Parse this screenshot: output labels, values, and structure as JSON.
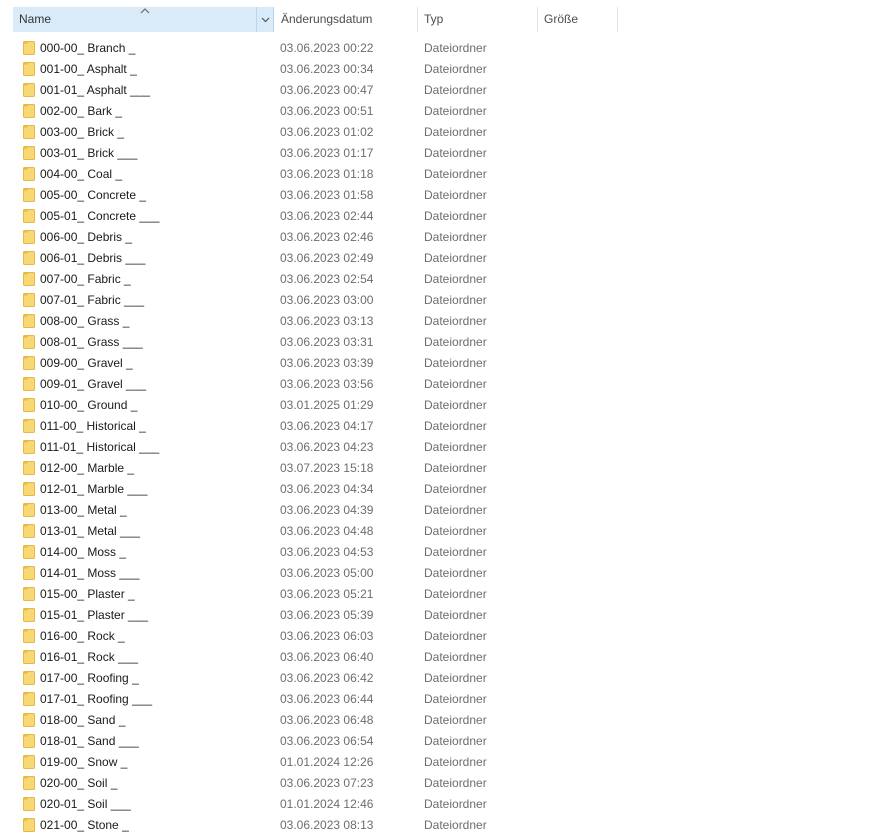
{
  "columns": {
    "name": "Name",
    "date": "Änderungsdatum",
    "type": "Typ",
    "size": "Größe"
  },
  "icons": {
    "folder": "folder-icon",
    "sort": "sort-ascending-icon",
    "dropdown": "chevron-down-icon",
    "folder_color": "#f8d775",
    "folder_edge": "#e6b944",
    "header_selected_bg": "#d9ebf9"
  },
  "files": [
    {
      "name": "000-00_ Branch _",
      "date": "03.06.2023 00:22",
      "type": "Dateiordner",
      "size": ""
    },
    {
      "name": "001-00_ Asphalt _",
      "date": "03.06.2023 00:34",
      "type": "Dateiordner",
      "size": ""
    },
    {
      "name": "001-01_ Asphalt ___",
      "date": "03.06.2023 00:47",
      "type": "Dateiordner",
      "size": ""
    },
    {
      "name": "002-00_ Bark _",
      "date": "03.06.2023 00:51",
      "type": "Dateiordner",
      "size": ""
    },
    {
      "name": "003-00_ Brick _",
      "date": "03.06.2023 01:02",
      "type": "Dateiordner",
      "size": ""
    },
    {
      "name": "003-01_ Brick ___",
      "date": "03.06.2023 01:17",
      "type": "Dateiordner",
      "size": ""
    },
    {
      "name": "004-00_ Coal _",
      "date": "03.06.2023 01:18",
      "type": "Dateiordner",
      "size": ""
    },
    {
      "name": "005-00_ Concrete _",
      "date": "03.06.2023 01:58",
      "type": "Dateiordner",
      "size": ""
    },
    {
      "name": "005-01_ Concrete ___",
      "date": "03.06.2023 02:44",
      "type": "Dateiordner",
      "size": ""
    },
    {
      "name": "006-00_ Debris _",
      "date": "03.06.2023 02:46",
      "type": "Dateiordner",
      "size": ""
    },
    {
      "name": "006-01_ Debris ___",
      "date": "03.06.2023 02:49",
      "type": "Dateiordner",
      "size": ""
    },
    {
      "name": "007-00_ Fabric _",
      "date": "03.06.2023 02:54",
      "type": "Dateiordner",
      "size": ""
    },
    {
      "name": "007-01_ Fabric ___",
      "date": "03.06.2023 03:00",
      "type": "Dateiordner",
      "size": ""
    },
    {
      "name": "008-00_ Grass _",
      "date": "03.06.2023 03:13",
      "type": "Dateiordner",
      "size": ""
    },
    {
      "name": "008-01_ Grass ___",
      "date": "03.06.2023 03:31",
      "type": "Dateiordner",
      "size": ""
    },
    {
      "name": "009-00_ Gravel _",
      "date": "03.06.2023 03:39",
      "type": "Dateiordner",
      "size": ""
    },
    {
      "name": "009-01_ Gravel ___",
      "date": "03.06.2023 03:56",
      "type": "Dateiordner",
      "size": ""
    },
    {
      "name": "010-00_ Ground _",
      "date": "03.01.2025 01:29",
      "type": "Dateiordner",
      "size": ""
    },
    {
      "name": "011-00_ Historical _",
      "date": "03.06.2023 04:17",
      "type": "Dateiordner",
      "size": ""
    },
    {
      "name": "011-01_ Historical ___",
      "date": "03.06.2023 04:23",
      "type": "Dateiordner",
      "size": ""
    },
    {
      "name": "012-00_ Marble _",
      "date": "03.07.2023 15:18",
      "type": "Dateiordner",
      "size": ""
    },
    {
      "name": "012-01_ Marble ___",
      "date": "03.06.2023 04:34",
      "type": "Dateiordner",
      "size": ""
    },
    {
      "name": "013-00_ Metal _",
      "date": "03.06.2023 04:39",
      "type": "Dateiordner",
      "size": ""
    },
    {
      "name": "013-01_ Metal ___",
      "date": "03.06.2023 04:48",
      "type": "Dateiordner",
      "size": ""
    },
    {
      "name": "014-00_ Moss _",
      "date": "03.06.2023 04:53",
      "type": "Dateiordner",
      "size": ""
    },
    {
      "name": "014-01_ Moss ___",
      "date": "03.06.2023 05:00",
      "type": "Dateiordner",
      "size": ""
    },
    {
      "name": "015-00_ Plaster _",
      "date": "03.06.2023 05:21",
      "type": "Dateiordner",
      "size": ""
    },
    {
      "name": "015-01_ Plaster ___",
      "date": "03.06.2023 05:39",
      "type": "Dateiordner",
      "size": ""
    },
    {
      "name": "016-00_ Rock _",
      "date": "03.06.2023 06:03",
      "type": "Dateiordner",
      "size": ""
    },
    {
      "name": "016-01_ Rock ___",
      "date": "03.06.2023 06:40",
      "type": "Dateiordner",
      "size": ""
    },
    {
      "name": "017-00_ Roofing _",
      "date": "03.06.2023 06:42",
      "type": "Dateiordner",
      "size": ""
    },
    {
      "name": "017-01_ Roofing ___",
      "date": "03.06.2023 06:44",
      "type": "Dateiordner",
      "size": ""
    },
    {
      "name": "018-00_ Sand _",
      "date": "03.06.2023 06:48",
      "type": "Dateiordner",
      "size": ""
    },
    {
      "name": "018-01_ Sand ___",
      "date": "03.06.2023 06:54",
      "type": "Dateiordner",
      "size": ""
    },
    {
      "name": "019-00_ Snow _",
      "date": "01.01.2024 12:26",
      "type": "Dateiordner",
      "size": ""
    },
    {
      "name": "020-00_ Soil _",
      "date": "03.06.2023 07:23",
      "type": "Dateiordner",
      "size": ""
    },
    {
      "name": "020-01_ Soil ___",
      "date": "01.01.2024 12:46",
      "type": "Dateiordner",
      "size": ""
    },
    {
      "name": "021-00_ Stone _",
      "date": "03.06.2023 08:13",
      "type": "Dateiordner",
      "size": ""
    }
  ]
}
